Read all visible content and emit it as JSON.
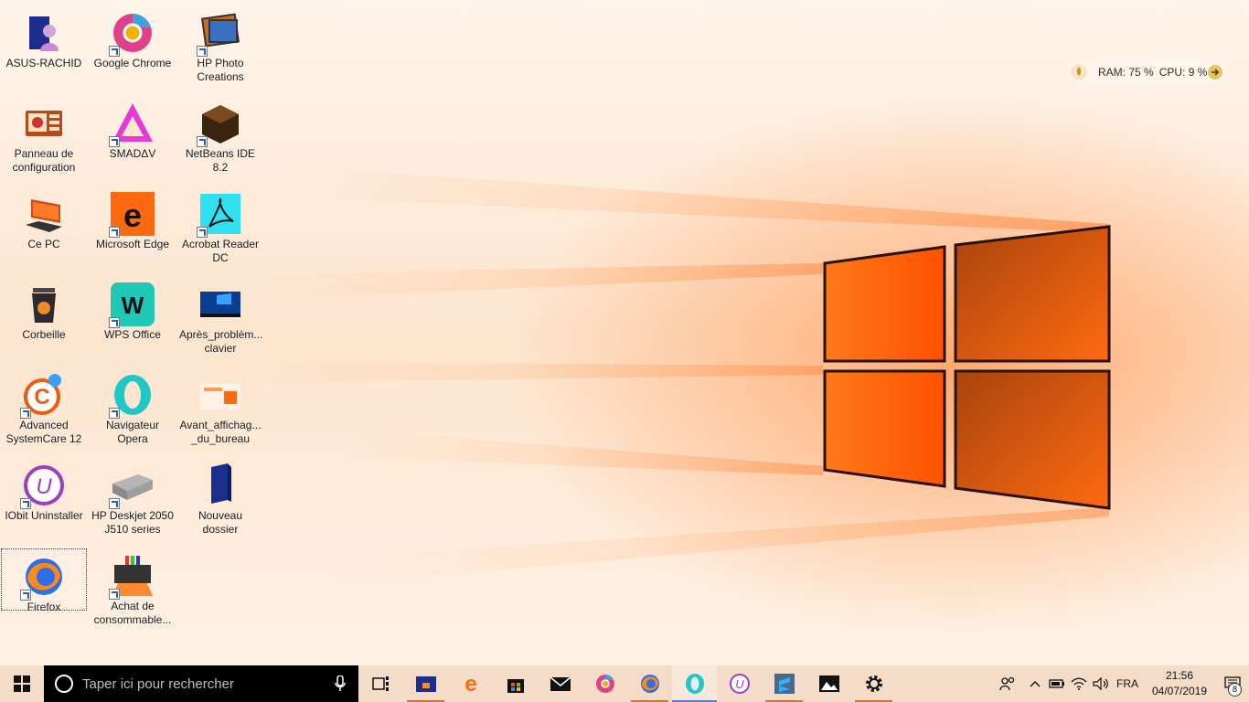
{
  "desktop": {
    "icons": [
      {
        "label": "ASUS-RACHID"
      },
      {
        "label": "Google Chrome"
      },
      {
        "label": "HP Photo Creations"
      },
      {
        "label": "Panneau de configuration"
      },
      {
        "label": "SMADΔV"
      },
      {
        "label": "NetBeans IDE 8.2"
      },
      {
        "label": "Ce PC"
      },
      {
        "label": "Microsoft Edge"
      },
      {
        "label": "Acrobat Reader DC"
      },
      {
        "label": "Corbeille"
      },
      {
        "label": "WPS Office"
      },
      {
        "label": "Après_problèm... clavier"
      },
      {
        "label": "Advanced SystemCare 12"
      },
      {
        "label": "Navigateur Opera"
      },
      {
        "label": "Avant_affichag... _du_bureau"
      },
      {
        "label": "IObit Uninstaller"
      },
      {
        "label": "HP Deskjet 2050 J510 series"
      },
      {
        "label": "Nouveau dossier"
      },
      {
        "label": "Firefox"
      },
      {
        "label": "Achat de consommable..."
      }
    ]
  },
  "widget": {
    "ram": "RAM: 75 %",
    "cpu": "CPU: 9 %"
  },
  "taskbar": {
    "search_placeholder": "Taper ici pour rechercher",
    "pinned": [
      "task-view",
      "file-explorer",
      "microsoft-edge",
      "microsoft-store",
      "mail",
      "google-chrome",
      "firefox",
      "opera",
      "iobit-uninstaller",
      "sublime-text",
      "photos",
      "settings"
    ],
    "language": "FRA",
    "time": "21:56",
    "date": "04/07/2019",
    "notification_count": "8"
  },
  "colors": {
    "accent": "#ff6a10",
    "taskbar": "#f4dcc8",
    "search_bg": "#000000"
  }
}
